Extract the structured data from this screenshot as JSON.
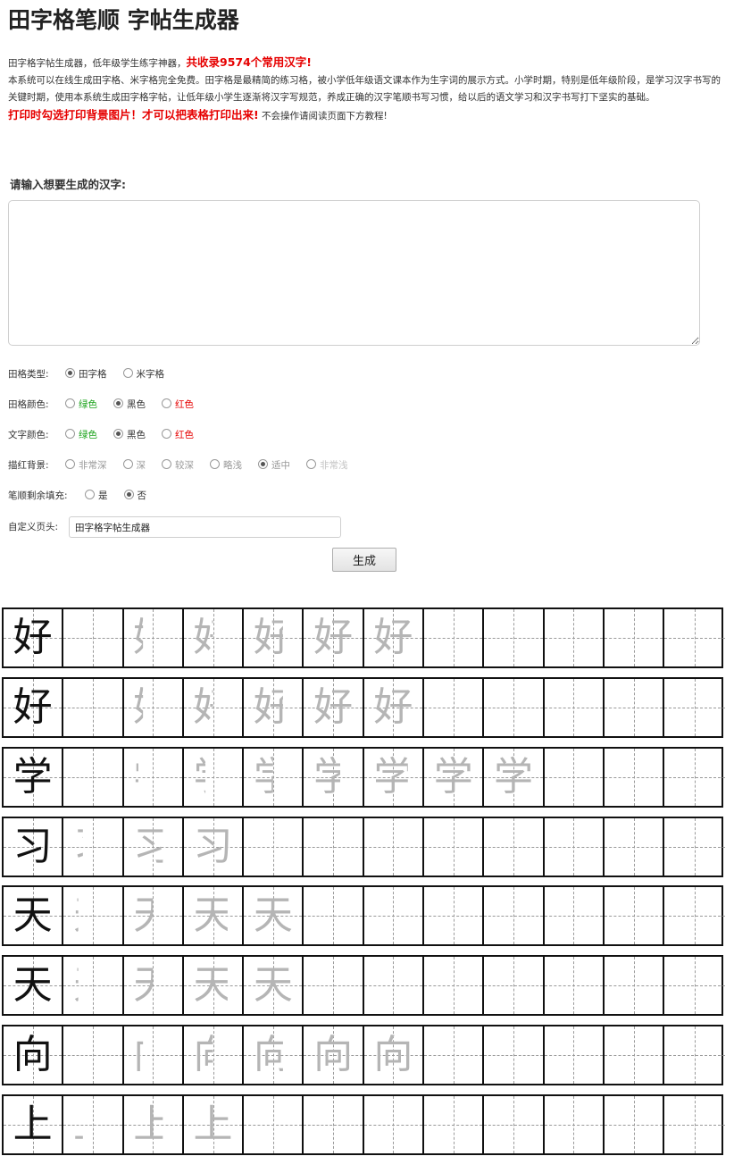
{
  "page": {
    "title": "田字格笔顺 字帖生成器"
  },
  "intro": {
    "line1_text": "田字格字帖生成器，低年级学生练字神器，",
    "line1_highlight": "共收录9574个常用汉字!",
    "paragraph": "本系统可以在线生成田字格、米字格完全免费。田字格是最精简的练习格，被小学低年级语文课本作为生字词的展示方式。小学时期，特别是低年级阶段，是学习汉字书写的关键时期，使用本系统生成田字格字帖，让低年级小学生逐渐将汉字写规范，养成正确的汉字笔顺书写习惯，给以后的语文学习和汉字书写打下坚实的基础。",
    "print_tip": "打印时勾选打印背景图片！才可以把表格打印出来!",
    "tutorial_tip": "不会操作请阅读页面下方教程!"
  },
  "form": {
    "input_label": "请输入想要生成的汉字:",
    "input_value": "",
    "grid_type": {
      "label": "田格类型:",
      "options": [
        {
          "text": "田字格",
          "selected": true,
          "color": "normal"
        },
        {
          "text": "米字格",
          "selected": false,
          "color": "normal"
        }
      ]
    },
    "grid_color": {
      "label": "田格颜色:",
      "options": [
        {
          "text": "绿色",
          "selected": false,
          "color": "green"
        },
        {
          "text": "黑色",
          "selected": true,
          "color": "normal"
        },
        {
          "text": "红色",
          "selected": false,
          "color": "red"
        }
      ]
    },
    "text_color": {
      "label": "文字颜色:",
      "options": [
        {
          "text": "绿色",
          "selected": false,
          "color": "green"
        },
        {
          "text": "黑色",
          "selected": true,
          "color": "normal"
        },
        {
          "text": "红色",
          "selected": false,
          "color": "red"
        }
      ]
    },
    "trace_bg": {
      "label": "描红背景:",
      "options": [
        {
          "text": "非常深",
          "selected": false,
          "color": "grey"
        },
        {
          "text": "深",
          "selected": false,
          "color": "grey"
        },
        {
          "text": "较深",
          "selected": false,
          "color": "grey"
        },
        {
          "text": "略浅",
          "selected": false,
          "color": "grey"
        },
        {
          "text": "适中",
          "selected": true,
          "color": "grey"
        },
        {
          "text": "非常浅",
          "selected": false,
          "color": "lightgrey"
        }
      ]
    },
    "fill_rest": {
      "label": "笔顺剩余填充:",
      "options": [
        {
          "text": "是",
          "selected": false,
          "color": "normal"
        },
        {
          "text": "否",
          "selected": true,
          "color": "normal"
        }
      ]
    },
    "custom_header": {
      "label": "自定义页头:",
      "value": "田字格字帖生成器"
    },
    "generate_label": "生成"
  },
  "colors": {
    "highlight_red": "#e60000",
    "green": "#1aa31a",
    "trace_grey": "#b5b5b5",
    "grid_line": "#111111"
  },
  "practice_rows": [
    {
      "char": "好",
      "steps": 6
    },
    {
      "char": "好",
      "steps": 6
    },
    {
      "char": "学",
      "steps": 8
    },
    {
      "char": "习",
      "steps": 3
    },
    {
      "char": "天",
      "steps": 4
    },
    {
      "char": "天",
      "steps": 4
    },
    {
      "char": "向",
      "steps": 6
    },
    {
      "char": "上",
      "steps": 3
    }
  ]
}
